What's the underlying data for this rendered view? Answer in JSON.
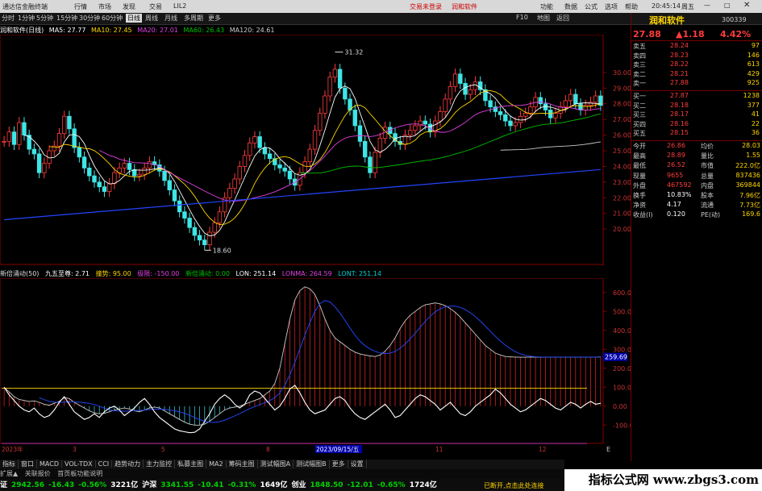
{
  "window": {
    "app_title": "通达信金融终端",
    "top_menus": [
      "行情",
      "市场",
      "发现",
      "交易",
      "LIL2"
    ],
    "center_links": [
      "交易未登录",
      "润和软件"
    ],
    "right_menus": [
      "功能",
      "数据",
      "公式",
      "选项",
      "帮助"
    ],
    "clock": "20:45:14",
    "right_label": "周五"
  },
  "periods": [
    "分时",
    "1分钟",
    "5分钟",
    "15分钟",
    "30分钟",
    "60分钟",
    "日线",
    "周线",
    "月线",
    "多周期",
    "更多"
  ],
  "active_period": "日线",
  "tools_right": [
    "F10",
    "地图",
    "返回"
  ],
  "chart": {
    "stock_label": "润和软件(日线)",
    "ma_legend": [
      {
        "label": "MA5: 27.77",
        "color": "#ffffff"
      },
      {
        "label": "MA10: 27.45",
        "color": "#ffd700"
      },
      {
        "label": "MA20: 27.01",
        "color": "#e040e0"
      },
      {
        "label": "MA60: 26.43",
        "color": "#00c000"
      },
      {
        "label": "MA120: 24.61",
        "color": "#cccccc"
      }
    ],
    "high_label": "31.32",
    "low_label": "18.60",
    "price_axis": [
      "30.00",
      "29.00",
      "28.00",
      "27.00",
      "26.00",
      "25.00",
      "24.00",
      "23.00",
      "22.00",
      "21.00",
      "20.00"
    ],
    "indicator_legend": [
      {
        "label": "新倍涌动(50)",
        "color": "#dddddd"
      },
      {
        "label": "九五至尊: 2.71",
        "color": "#ffffff"
      },
      {
        "label": "撞势: 95.00",
        "color": "#ffd700"
      },
      {
        "label": "极限: -150.00",
        "color": "#e040e0"
      },
      {
        "label": "新倍涌动: 0.00",
        "color": "#00c000"
      },
      {
        "label": "LON: 251.14",
        "color": "#ffffff"
      },
      {
        "label": "LONMA: 264.59",
        "color": "#e040e0"
      },
      {
        "label": "LONT: 251.14",
        "color": "#00d0d0"
      }
    ],
    "ind_axis": [
      "600.0",
      "500.0",
      "400.0",
      "300.0",
      "200.0",
      "100.0",
      "0.00",
      "-100.0"
    ],
    "ind_marker": "259.69",
    "date_axis": [
      "2023年",
      "3",
      "5",
      "8",
      "2023/09/15/五",
      "11",
      "12"
    ],
    "axis_corner": "E"
  },
  "chart_data": {
    "type": "candlestick",
    "x_index": [
      0,
      1,
      2,
      3,
      4,
      5,
      6,
      7,
      8,
      9,
      10,
      11,
      12,
      13,
      14,
      15,
      16,
      17,
      18,
      19,
      20,
      21,
      22,
      23,
      24,
      25,
      26,
      27,
      28,
      29,
      30,
      31,
      32,
      33,
      34,
      35,
      36,
      37,
      38,
      39,
      40,
      41,
      42,
      43,
      44,
      45,
      46,
      47,
      48,
      49,
      50,
      51,
      52,
      53,
      54,
      55,
      56,
      57,
      58,
      59,
      60,
      61,
      62,
      63,
      64,
      65,
      66,
      67,
      68,
      69,
      70,
      71,
      72,
      73,
      74,
      75,
      76,
      77,
      78,
      79,
      80,
      81,
      82,
      83,
      84,
      85,
      86,
      87,
      88,
      89,
      90,
      91,
      92,
      93,
      94,
      95,
      96,
      97,
      98,
      99,
      100,
      101,
      102,
      103,
      104,
      105,
      106,
      107,
      108,
      109,
      110,
      111,
      112,
      113,
      114,
      115,
      116,
      117,
      118,
      119
    ],
    "close": [
      25.6,
      26.2,
      25.4,
      26.8,
      26.0,
      25.1,
      24.8,
      23.6,
      24.2,
      25.0,
      25.3,
      26.1,
      27.2,
      26.4,
      25.2,
      24.6,
      23.9,
      23.4,
      23.0,
      22.7,
      22.4,
      22.9,
      23.6,
      23.9,
      24.2,
      23.8,
      23.4,
      23.5,
      23.9,
      24.3,
      24.1,
      23.7,
      23.1,
      22.5,
      21.8,
      21.1,
      20.7,
      20.1,
      19.6,
      19.3,
      19.0,
      19.8,
      20.4,
      21.1,
      22.0,
      22.6,
      23.2,
      24.0,
      24.7,
      25.5,
      25.9,
      25.2,
      24.8,
      24.5,
      24.1,
      23.9,
      23.7,
      23.2,
      22.8,
      23.6,
      24.3,
      25.1,
      26.3,
      27.4,
      28.5,
      29.7,
      30.2,
      29.0,
      28.3,
      27.6,
      26.6,
      25.6,
      24.6,
      23.6,
      24.9,
      25.8,
      26.5,
      26.1,
      25.6,
      25.4,
      26.0,
      26.3,
      26.6,
      26.9,
      26.7,
      26.2,
      26.9,
      27.5,
      28.3,
      29.1,
      29.9,
      29.3,
      28.6,
      28.9,
      29.4,
      28.9,
      28.2,
      27.8,
      27.5,
      27.3,
      26.9,
      26.6,
      26.8,
      27.2,
      27.4,
      27.8,
      28.4,
      28.0,
      27.6,
      27.1,
      27.4,
      27.8,
      28.2,
      28.6,
      28.0,
      27.6,
      27.9,
      28.1,
      28.5,
      27.9
    ],
    "lon": [
      100,
      75,
      50,
      35,
      30,
      25,
      28,
      20,
      10,
      5,
      15,
      25,
      45,
      40,
      20,
      5,
      -10,
      -25,
      -35,
      -40,
      -38,
      -30,
      -20,
      -15,
      -10,
      -15,
      -25,
      -30,
      -20,
      -10,
      -5,
      -10,
      -25,
      -40,
      -55,
      -70,
      -85,
      -95,
      -100,
      -100,
      -95,
      -80,
      -60,
      -40,
      -20,
      -10,
      -5,
      0,
      10,
      20,
      30,
      40,
      60,
      80,
      120,
      200,
      330,
      460,
      560,
      610,
      630,
      620,
      590,
      530,
      460,
      400,
      360,
      340,
      320,
      300,
      285,
      275,
      270,
      265,
      262,
      270,
      290,
      320,
      360,
      410,
      450,
      480,
      500,
      520,
      535,
      540,
      545,
      540,
      530,
      515,
      495,
      470,
      440,
      410,
      380,
      350,
      320,
      300,
      280,
      270,
      262,
      260,
      259,
      258,
      258,
      259,
      259,
      259,
      259,
      259,
      259,
      259,
      259,
      259,
      259,
      259,
      259,
      259,
      259,
      260
    ],
    "fast": [
      100,
      60,
      30,
      0,
      -20,
      -30,
      -10,
      -40,
      -60,
      -50,
      -20,
      20,
      50,
      10,
      -30,
      -50,
      -70,
      -60,
      -40,
      -60,
      -30,
      -10,
      0,
      -20,
      -50,
      -30,
      -10,
      20,
      40,
      10,
      -30,
      -60,
      -80,
      -100,
      -120,
      -130,
      -135,
      -140,
      -138,
      -120,
      -80,
      -40,
      10,
      40,
      60,
      40,
      10,
      -10,
      10,
      60,
      80,
      70,
      40,
      10,
      -20,
      0,
      40,
      90,
      110,
      70,
      20,
      -20,
      -40,
      -30,
      -20,
      10,
      40,
      50,
      30,
      -10,
      -40,
      -60,
      -70,
      -50,
      -30,
      -10,
      10,
      -20,
      -60,
      -50,
      -20,
      10,
      40,
      60,
      50,
      30,
      10,
      -20,
      0,
      20,
      -10,
      -40,
      -50,
      -30,
      0,
      20,
      40,
      60,
      90,
      70,
      40,
      10,
      -10,
      -30,
      -20,
      0,
      20,
      40,
      30,
      10,
      -10,
      -20,
      0,
      20,
      10,
      -10,
      10,
      25,
      10,
      15
    ],
    "ylim_price": [
      18,
      32
    ],
    "ylim_ind": [
      -150,
      650
    ]
  },
  "right_panel": {
    "name": "润和软件",
    "code": "300339",
    "price": "27.88",
    "change": "▲1.18",
    "pct": "4.42%",
    "asks": [
      {
        "label": "卖五",
        "price": "28.24",
        "vol": "97"
      },
      {
        "label": "卖四",
        "price": "28.23",
        "vol": "146"
      },
      {
        "label": "卖三",
        "price": "28.22",
        "vol": "613"
      },
      {
        "label": "卖二",
        "price": "28.21",
        "vol": "429"
      },
      {
        "label": "卖一",
        "price": "27.88",
        "vol": "925"
      }
    ],
    "bids": [
      {
        "label": "买一",
        "price": "27.87",
        "vol": "1238"
      },
      {
        "label": "买二",
        "price": "28.18",
        "vol": "377"
      },
      {
        "label": "买三",
        "price": "28.17",
        "vol": "41"
      },
      {
        "label": "买四",
        "price": "28.16",
        "vol": "22"
      },
      {
        "label": "买五",
        "price": "28.15",
        "vol": "36"
      }
    ],
    "stats": [
      {
        "l1": "今开",
        "v1": "26.86",
        "l2": "均价",
        "v2": "28.03"
      },
      {
        "l1": "最高",
        "v1": "28.89",
        "l2": "量比",
        "v2": "1.55"
      },
      {
        "l1": "最低",
        "v1": "26.52",
        "l2": "市值",
        "v2": "222.0亿"
      },
      {
        "l1": "现量",
        "v1": "9655",
        "l2": "总量",
        "v2": "837436"
      },
      {
        "l1": "外盘",
        "v1": "467592",
        "l2": "内盘",
        "v2": "369844"
      },
      {
        "l1": "换手",
        "v1": "10.83%",
        "l2": "股本",
        "v2": "7.96亿"
      },
      {
        "l1": "净资",
        "v1": "4.17",
        "l2": "流通",
        "v2": "7.73亿"
      },
      {
        "l1": "收益(I)",
        "v1": "0.120",
        "l2": "PE(动)",
        "v2": "169.6"
      }
    ]
  },
  "tabs": [
    "指标",
    "窗口",
    "MACD",
    "VOL-TDX",
    "CCI",
    "趋势动力",
    "主力监控",
    "私募主图",
    "MA2",
    "筹码主图",
    "测试幅图A",
    "测试幅图B",
    "更多",
    "设置"
  ],
  "tools": [
    "扩展▲",
    "关联报价",
    "首页板功能说明"
  ],
  "status": [
    {
      "text": "证",
      "cls": "white"
    },
    {
      "text": "2942.56",
      "cls": "green"
    },
    {
      "text": "-16.43",
      "cls": "green"
    },
    {
      "text": "-0.56%",
      "cls": "green"
    },
    {
      "text": "3221亿",
      "cls": "white"
    },
    {
      "text": "沪深",
      "cls": "white"
    },
    {
      "text": "3341.55",
      "cls": "green"
    },
    {
      "text": "-10.41",
      "cls": "green"
    },
    {
      "text": "-0.31%",
      "cls": "green"
    },
    {
      "text": "1649亿",
      "cls": "white"
    },
    {
      "text": "创业",
      "cls": "white"
    },
    {
      "text": "1848.50",
      "cls": "green"
    },
    {
      "text": "-12.01",
      "cls": "green"
    },
    {
      "text": "-0.65%",
      "cls": "green"
    },
    {
      "text": "1724亿",
      "cls": "white"
    }
  ],
  "status_tail": "已断开,点击此处连接",
  "watermark": "指标公式网 www.zbgs3.com"
}
